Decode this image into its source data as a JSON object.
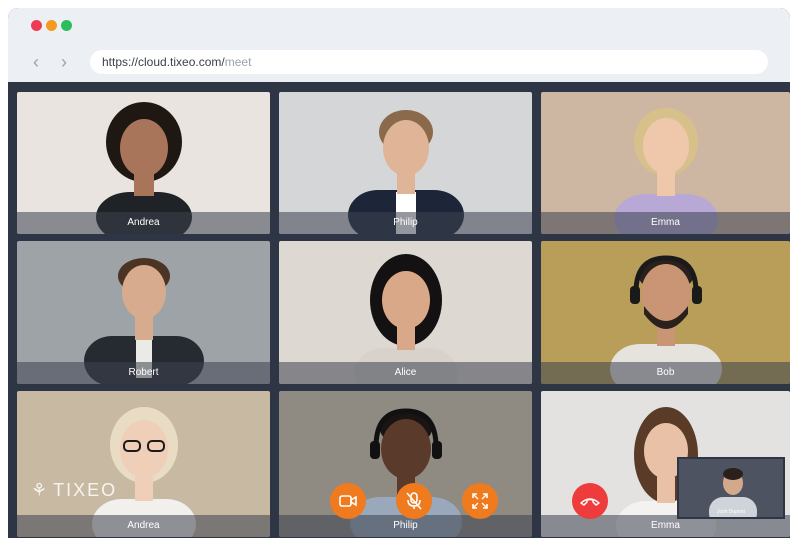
{
  "window": {
    "url_base": "https://cloud.tixeo.com/",
    "url_path": "meet"
  },
  "participants": [
    {
      "name": "Andrea",
      "bg": "#e9e4df",
      "skin": "#a8745a",
      "hair": "#1e1712",
      "cloth": "#1f2227"
    },
    {
      "name": "Philip",
      "bg": "#d4d6d8",
      "skin": "#e0b597",
      "hair": "#8a6a4a",
      "cloth": "#1d2638"
    },
    {
      "name": "Emma",
      "bg": "#cdb7a2",
      "skin": "#efc8ab",
      "hair": "#d8c08a",
      "cloth": "#b7a8d6"
    },
    {
      "name": "Robert",
      "bg": "#9ea3a8",
      "skin": "#d7ac8e",
      "hair": "#4b3424",
      "cloth": "#262a31"
    },
    {
      "name": "Alice",
      "bg": "#ddd8d2",
      "skin": "#d9a888",
      "hair": "#141112",
      "cloth": "#d8d2cb"
    },
    {
      "name": "Bob",
      "bg": "#b99e5a",
      "skin": "#c99575",
      "hair": "#2a211c",
      "cloth": "#e6e3df"
    },
    {
      "name": "Andrea",
      "bg": "#c8b9a3",
      "skin": "#efcfb8",
      "hair": "#e8dcc4",
      "cloth": "#f2f0ed"
    },
    {
      "name": "Philip",
      "bg": "#8f8a82",
      "skin": "#5a3a2a",
      "hair": "#1a1412",
      "cloth": "#9aa8bb"
    },
    {
      "name": "Emma",
      "bg": "#e3e2e0",
      "skin": "#e9c1a6",
      "hair": "#5a3b28",
      "cloth": "#f3f2f1"
    }
  ],
  "brand": {
    "logo_text": "TIXEO"
  },
  "controls": [
    {
      "icon": "camera-icon"
    },
    {
      "icon": "mic-muted-icon"
    },
    {
      "icon": "fullscreen-icon"
    },
    {
      "icon": "hang-up-icon"
    }
  ],
  "self_view": {
    "label": "Josh Dupont"
  },
  "colors": {
    "accent": "#f07a1e",
    "hangup": "#ee3b3b",
    "frame": "#2e3646"
  }
}
